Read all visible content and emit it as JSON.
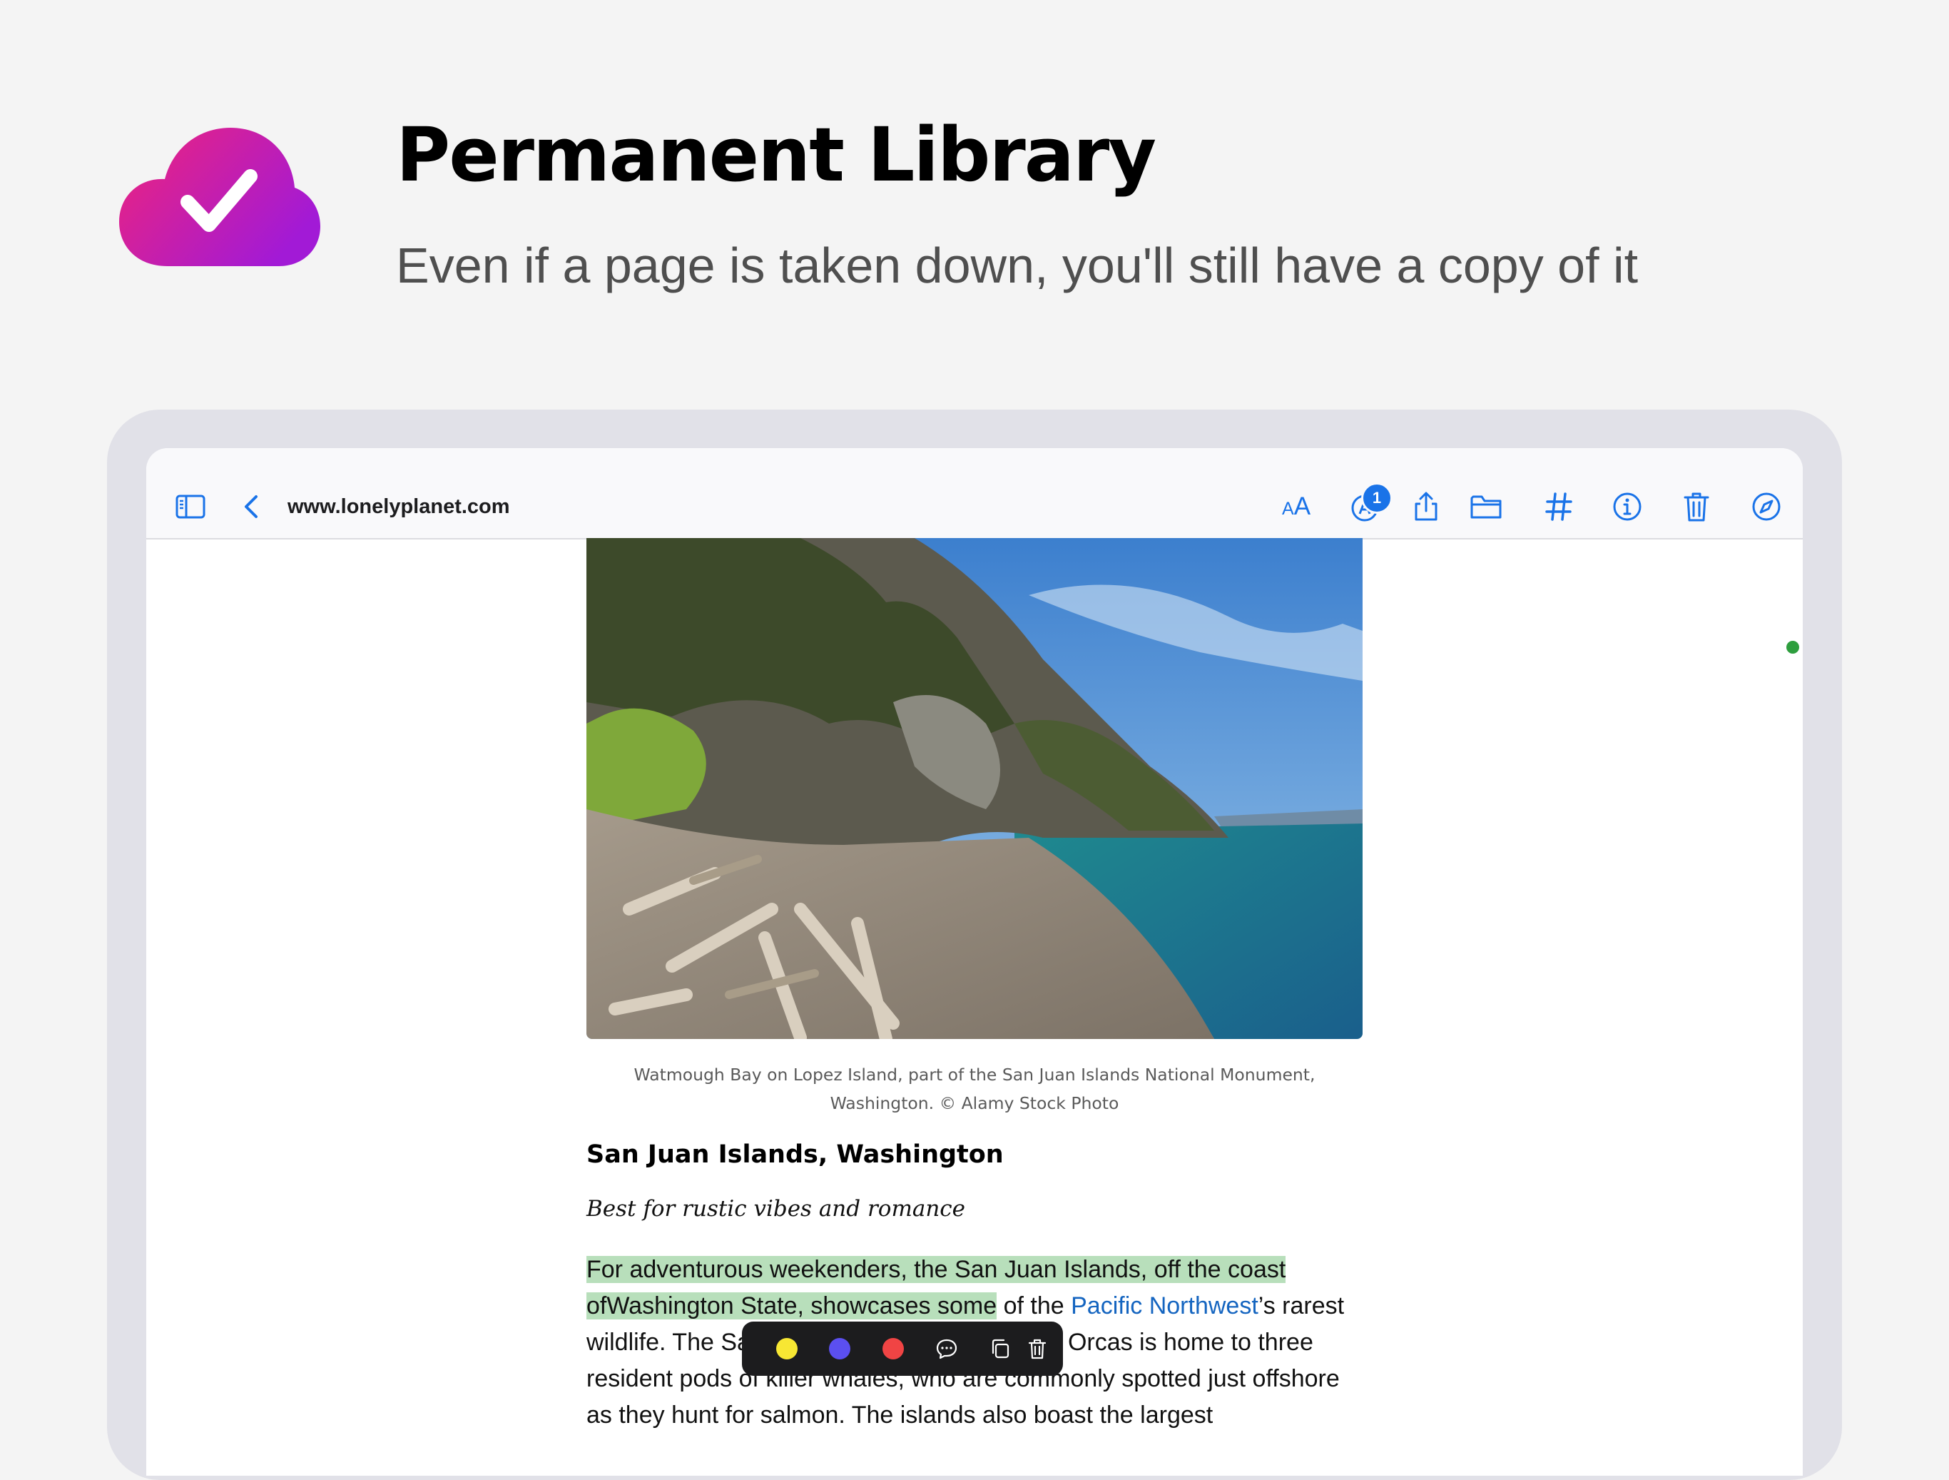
{
  "hero": {
    "title": "Permanent Library",
    "subtitle": "Even if a page is taken down, you'll still have a copy of it"
  },
  "toolbar": {
    "url": "www.lonelyplanet.com",
    "text_size_small": "A",
    "text_size_large": "A",
    "annotation_count": "1",
    "accent_color": "#1a73e8",
    "icons": [
      "sidebar-icon",
      "back-chevron-icon",
      "text-size-icon",
      "annotations-icon",
      "share-icon",
      "folder-icon",
      "hashtag-icon",
      "info-icon",
      "trash-icon",
      "compass-icon"
    ]
  },
  "article": {
    "caption_line1": "Watmough Bay on Lopez Island, part of the San Juan Islands National Monument,",
    "caption_line2": "Washington. © Alamy Stock Photo",
    "title": "San Juan Islands, Washington",
    "subtitle": "Best for rustic vibes and romance",
    "body": {
      "l1": "For adventurous weekenders, the San Juan Islands, off the coast",
      "l2_highlight": "ofWashington State, showcases some",
      "l2_pre": " of the ",
      "l2_link": "Pacific Northwest",
      "l2_post": "’s rarest",
      "l3_a": "wildlife. The Sa",
      "l3_b": "Orcas is home to three",
      "l4": "resident pods of killer whales, who are commonly spotted just offshore",
      "l5": "as they hunt for salmon. The islands also boast the largest"
    },
    "highlight_color": "#b8dfbb"
  },
  "annotation_toolbar": {
    "colors": [
      "#f7e733",
      "#5b4ff0",
      "#f04444"
    ],
    "icons": [
      "comment-icon",
      "copy-icon",
      "delete-icon"
    ]
  }
}
